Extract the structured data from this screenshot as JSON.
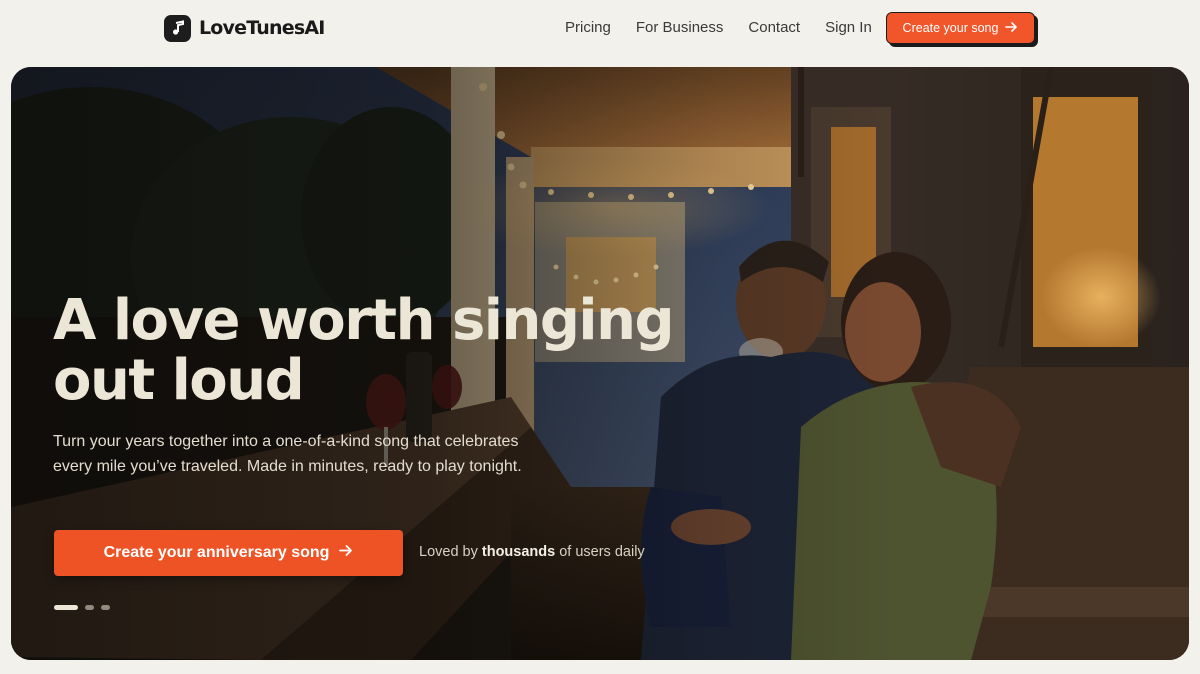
{
  "brand": {
    "name": "LoveTunesAI",
    "icon": "music-note-icon"
  },
  "nav": {
    "links": [
      {
        "label": "Pricing"
      },
      {
        "label": "For Business"
      },
      {
        "label": "Contact"
      },
      {
        "label": "Sign In"
      }
    ],
    "cta_label": "Create your song",
    "cta_icon": "arrow-right-icon"
  },
  "hero": {
    "headline_line1": "A love worth singing",
    "headline_line2": "out loud",
    "subtext": "Turn your years together into a one-of-a-kind song that celebrates every mile you’ve traveled. Made in minutes, ready to play tonight.",
    "cta_label": "Create your anniversary song",
    "cta_icon": "arrow-right-icon",
    "social_proof_prefix": "Loved by ",
    "social_proof_bold": "thousands",
    "social_proof_suffix": " of users daily",
    "carousel": {
      "slides": 3,
      "active_index": 0
    }
  },
  "colors": {
    "accent": "#f1552a",
    "page_background": "#f3f1ec",
    "headline": "#ece6d6"
  }
}
